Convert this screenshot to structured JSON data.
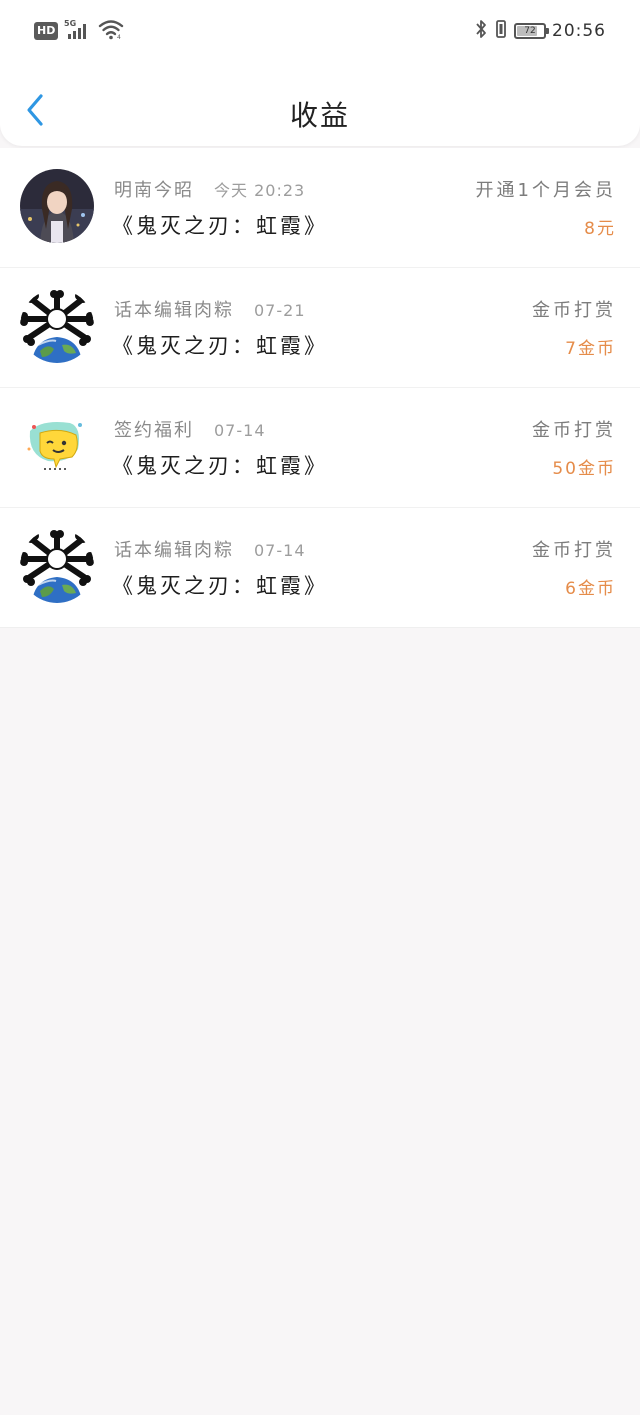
{
  "status_bar": {
    "hd_label": "HD",
    "network_label": "5G",
    "battery_level": "72",
    "battery_fraction": 0.72,
    "time": "20:56"
  },
  "header": {
    "title": "收益",
    "back_icon": "chevron-left-icon",
    "accent_color": "#2f97e3"
  },
  "colors": {
    "amount": "#e58c4a"
  },
  "earnings": [
    {
      "name": "明南今昭",
      "time": "今天 20:23",
      "book": "《鬼灭之刃：虹霞》",
      "type": "开通1个月会员",
      "amount": "8元",
      "avatar": "anime-girl-avatar"
    },
    {
      "name": "话本编辑肉粽",
      "time": "07-21",
      "book": "《鬼灭之刃：虹霞》",
      "type": "金币打赏",
      "amount": "7金币",
      "avatar": "earth-bones-avatar"
    },
    {
      "name": "签约福利",
      "time": "07-14",
      "book": "《鬼灭之刃：虹霞》",
      "type": "金币打赏",
      "amount": "50金币",
      "avatar": "chat-bubble-avatar"
    },
    {
      "name": "话本编辑肉粽",
      "time": "07-14",
      "book": "《鬼灭之刃：虹霞》",
      "type": "金币打赏",
      "amount": "6金币",
      "avatar": "earth-bones-avatar"
    }
  ]
}
